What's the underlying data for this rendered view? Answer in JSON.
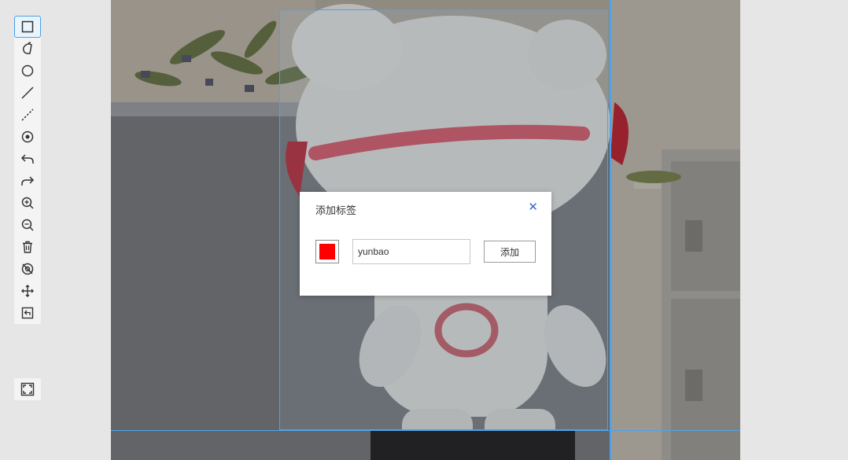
{
  "toolbar": {
    "tools": [
      {
        "name": "rect-tool",
        "icon": "square-icon",
        "active": true
      },
      {
        "name": "polygon-tool",
        "icon": "lasso-icon"
      },
      {
        "name": "circle-tool",
        "icon": "circle-icon"
      },
      {
        "name": "line-tool",
        "icon": "line-icon"
      },
      {
        "name": "dashed-line-tool",
        "icon": "dashed-line-icon"
      },
      {
        "name": "point-tool",
        "icon": "point-icon"
      },
      {
        "name": "undo-tool",
        "icon": "undo-icon"
      },
      {
        "name": "redo-tool",
        "icon": "redo-icon"
      },
      {
        "name": "zoom-in-tool",
        "icon": "zoom-in-icon"
      },
      {
        "name": "zoom-out-tool",
        "icon": "zoom-out-icon"
      },
      {
        "name": "delete-tool",
        "icon": "trash-icon"
      },
      {
        "name": "hide-tool",
        "icon": "eye-off-icon"
      },
      {
        "name": "move-tool",
        "icon": "move-icon"
      },
      {
        "name": "export-tool",
        "icon": "export-icon"
      }
    ],
    "fit_icon": "fullscreen-icon"
  },
  "dialog": {
    "title": "添加标签",
    "close_label": "✕",
    "color": "#ff0000",
    "input_value": "yunbao",
    "add_label": "添加"
  },
  "colors": {
    "accent": "#4ea3e8",
    "close": "#3a6ad4"
  }
}
